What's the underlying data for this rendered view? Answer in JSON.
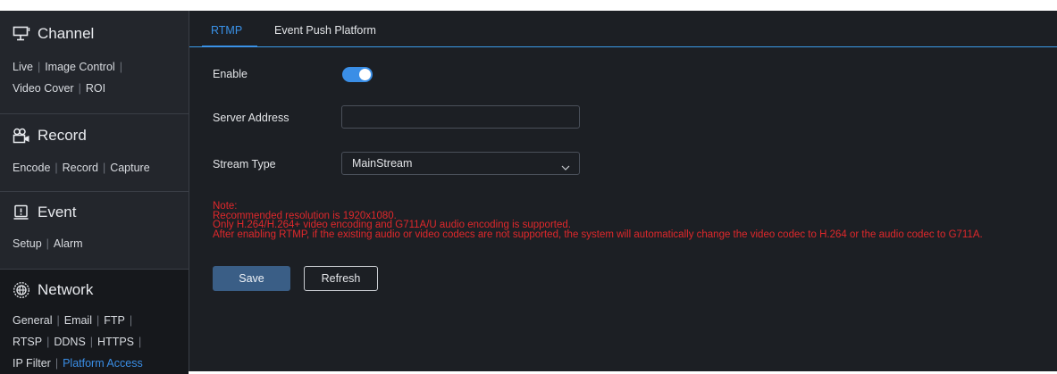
{
  "sidebar": {
    "channel": {
      "title": "Channel",
      "icon": "monitor-icon",
      "links": [
        "Live",
        "Image Control",
        "Video Cover",
        "ROI"
      ]
    },
    "record": {
      "title": "Record",
      "icon": "camera-recorder-icon",
      "links": [
        "Encode",
        "Record",
        "Capture"
      ]
    },
    "event": {
      "title": "Event",
      "icon": "alarm-light-icon",
      "links": [
        "Setup",
        "Alarm"
      ]
    },
    "network": {
      "title": "Network",
      "icon": "globe-icon",
      "links": [
        "General",
        "Email",
        "FTP",
        "RTSP",
        "DDNS",
        "HTTPS",
        "IP Filter",
        "Platform Access"
      ],
      "active": "Platform Access"
    }
  },
  "tabs": [
    {
      "label": "RTMP",
      "active": true
    },
    {
      "label": "Event Push Platform",
      "active": false
    }
  ],
  "form": {
    "enable_label": "Enable",
    "enable_on": true,
    "server_label": "Server Address",
    "server_value": "",
    "stream_label": "Stream Type",
    "stream_value": "MainStream"
  },
  "note": [
    "Note:",
    "Recommended resolution is 1920x1080.",
    "Only H.264/H.264+ video encoding and G711A/U audio encoding is supported.",
    "After enabling RTMP, if the existing audio or video codecs are not supported, the system will automatically change the video codec to H.264 or the audio codec to G711A."
  ],
  "buttons": {
    "save": "Save",
    "refresh": "Refresh"
  },
  "colors": {
    "accent": "#3a8ee6",
    "note": "#e0282b",
    "sidebar_bg": "#23262c",
    "main_bg": "#1c1f24"
  }
}
